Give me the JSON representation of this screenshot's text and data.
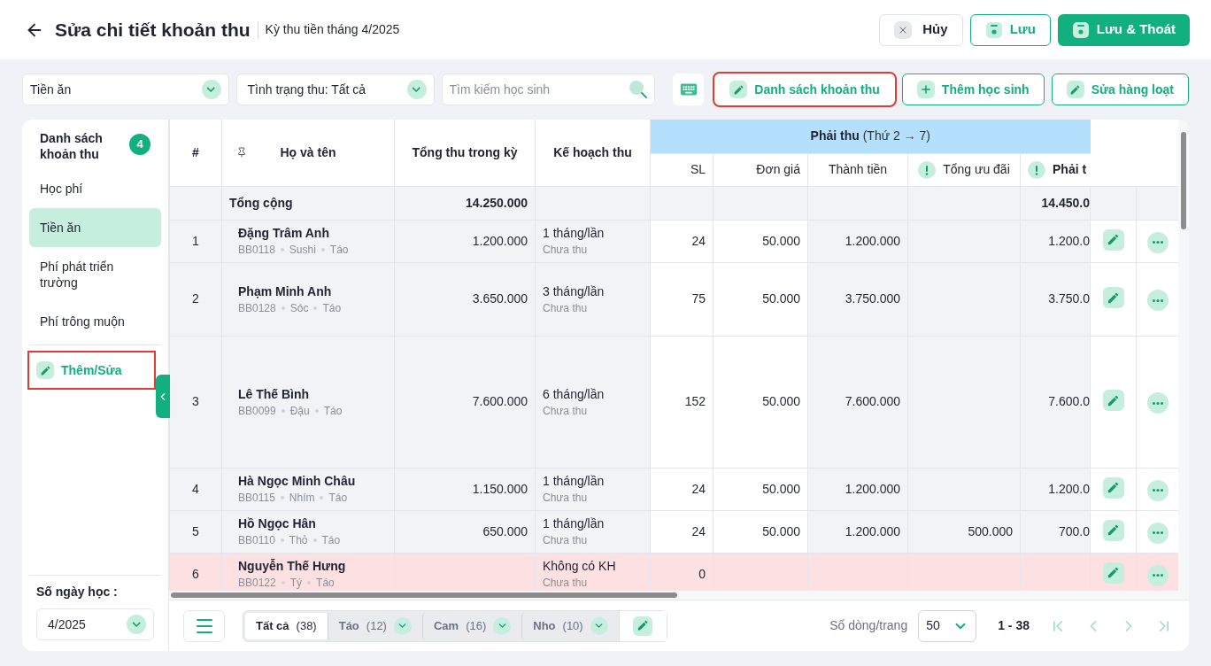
{
  "header": {
    "title": "Sửa chi tiết khoản thu",
    "subtitle": "Kỳ thu tiền tháng 4/2025",
    "buttons": [
      {
        "label": "Hủy",
        "kind": "cancel"
      },
      {
        "label": "Lưu",
        "kind": "save"
      },
      {
        "label": "Lưu & Thoát",
        "kind": "primary"
      }
    ]
  },
  "toolbar": {
    "fee_select": "Tiền ăn",
    "status_select": "Tình trạng thu: Tất cả",
    "search": {
      "placeholder": "Tìm kiếm học sinh"
    },
    "buttons": [
      {
        "label": "Danh sách khoản thu",
        "kind": "edit",
        "highlighted": true
      },
      {
        "label": "Thêm học sinh",
        "kind": "add",
        "highlighted": false
      },
      {
        "label": "Sửa hàng loạt",
        "kind": "edit",
        "highlighted": false
      }
    ]
  },
  "sidebar": {
    "title": "Danh sách khoản thu",
    "count": "4",
    "items": [
      {
        "label": "Học phí",
        "selected": false
      },
      {
        "label": "Tiền ăn",
        "selected": true
      },
      {
        "label": "Phí phát triển trường",
        "selected": false
      },
      {
        "label": "Phí trông muộn",
        "selected": false
      }
    ],
    "action": {
      "label": "Thêm/Sửa",
      "highlighted": true
    },
    "days": {
      "label": "Số ngày học :",
      "value": "4/2025"
    }
  },
  "table": {
    "group_header": {
      "label": "Phải thu",
      "note": "(Thứ 2 → 7)"
    },
    "columns": [
      {
        "label": "#",
        "pinned": false,
        "alert": false
      },
      {
        "label": "Họ và tên",
        "pinned": true,
        "alert": false
      },
      {
        "label": "Tổng thu trong kỳ",
        "pinned": false,
        "alert": false
      },
      {
        "label": "Kế hoạch thu",
        "pinned": false,
        "alert": false
      },
      {
        "label": "SL",
        "pinned": false,
        "alert": false
      },
      {
        "label": "Đơn giá",
        "pinned": false,
        "alert": false
      },
      {
        "label": "Thành tiền",
        "pinned": false,
        "alert": false
      },
      {
        "label": "Tổng ưu đãi",
        "pinned": false,
        "alert": true
      },
      {
        "label": "Phải t",
        "pinned": false,
        "alert": true
      }
    ],
    "total_row": {
      "label": "Tổng cộng",
      "total": "14.250.000",
      "due": "14.450.0"
    },
    "rows": [
      {
        "index": "1",
        "name": "Đặng Trâm Anh",
        "code": "BB0118",
        "class": "Sushi",
        "group": "Táo",
        "total": "1.200.000",
        "plan": "1 tháng/lần",
        "status": "Chưa thu",
        "qty": "24",
        "price": "50.000",
        "amount": "1.200.000",
        "due": "1.200.0",
        "kind": "normal"
      },
      {
        "index": "2",
        "name": "Phạm Minh Anh",
        "code": "BB0128",
        "class": "Sóc",
        "group": "Táo",
        "total": "3.650.000",
        "plan": "3 tháng/lần",
        "status": "Chưa thu",
        "qty": "75",
        "price": "50.000",
        "amount": "3.750.000",
        "due": "3.750.0",
        "kind": "normal"
      },
      {
        "index": "3",
        "name": "Lê Thế Bình",
        "code": "BB0099",
        "class": "Đậu",
        "group": "Táo",
        "total": "7.600.000",
        "plan": "6 tháng/lần",
        "status": "Chưa thu",
        "qty": "152",
        "price": "50.000",
        "amount": "7.600.000",
        "due": "7.600.0",
        "kind": "normal"
      },
      {
        "index": "4",
        "name": "Hà Ngọc Minh Châu",
        "code": "BB0115",
        "class": "Nhím",
        "group": "Táo",
        "total": "1.150.000",
        "plan": "1 tháng/lần",
        "status": "Chưa thu",
        "qty": "24",
        "price": "50.000",
        "amount": "1.200.000",
        "due": "1.200.0",
        "kind": "normal"
      },
      {
        "index": "5",
        "name": "Hồ Ngọc Hân",
        "code": "BB0110",
        "class": "Thỏ",
        "group": "Táo",
        "total": "650.000",
        "plan": "1 tháng/lần",
        "status": "Chưa thu",
        "qty": "24",
        "price": "50.000",
        "amount": "1.200.000",
        "discount": "500.000",
        "due": "700.0",
        "kind": "normal"
      },
      {
        "index": "6",
        "name": "Nguyễn Thế Hưng",
        "code": "BB0122",
        "class": "Tý",
        "group": "Táo",
        "plan": "Không có KH",
        "status": "Chưa thu",
        "qty": "0",
        "kind": "no_plan"
      }
    ]
  },
  "footer": {
    "tabs": [
      {
        "label": "Tất cả",
        "count": "(38)",
        "selected": true,
        "dropdown": false
      },
      {
        "label": "Táo",
        "count": "(12)",
        "selected": false,
        "dropdown": true
      },
      {
        "label": "Cam",
        "count": "(16)",
        "selected": false,
        "dropdown": true
      },
      {
        "label": "Nho",
        "count": "(10)",
        "selected": false,
        "dropdown": true
      }
    ],
    "page_size_label": "Số dòng/trang",
    "page_size": "50",
    "range": "1 - 38"
  }
}
